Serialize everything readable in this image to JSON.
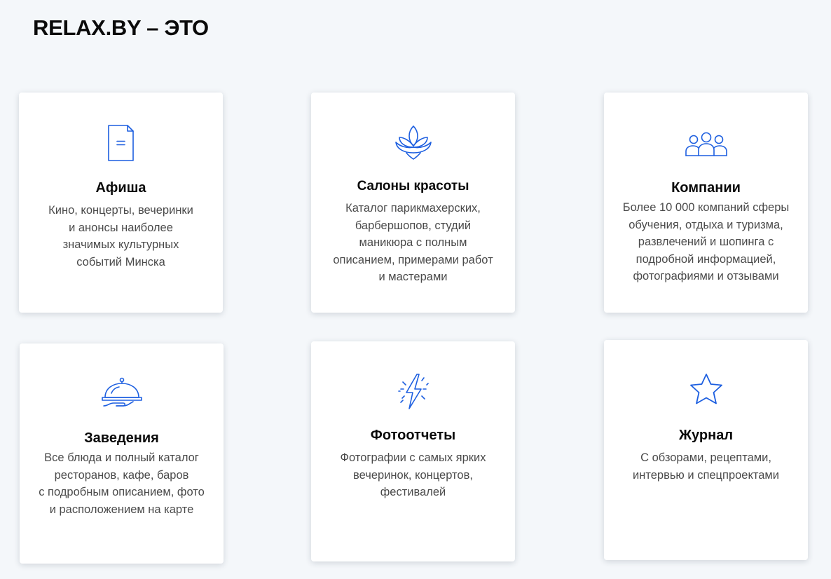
{
  "page": {
    "title": "RELAX.BY – ЭТО"
  },
  "colors": {
    "accent": "#1d5fe0",
    "background": "#f4f7fa",
    "card": "#ffffff"
  },
  "cards": [
    {
      "icon": "document-icon",
      "title": "Афиша",
      "description": "Кино, концерты, вечеринки\nи анонсы наиболее\nзначимых культурных\nсобытий Минска"
    },
    {
      "icon": "lotus-icon",
      "title": "Салоны красоты",
      "description": "Каталог парикмахерских,\nбарбершопов, студий\nманикюра с полным\nописанием, примерами работ\nи мастерами"
    },
    {
      "icon": "people-group-icon",
      "title": "Компании",
      "description": "Более 10 000 компаний сферы\nобучения, отдыха и туризма,\nразвлечений и шопинга с\nподробной информацией,\nфотографиями и отзывами"
    },
    {
      "icon": "cloche-serving-icon",
      "title": "Заведения",
      "description": "Все блюда и полный каталог\nресторанов, кафе, баров\nс подробным описанием, фото\nи расположением на карте"
    },
    {
      "icon": "lightning-icon",
      "title": "Фотоотчеты",
      "description": "Фотографии с самых ярких\nвечеринок, концертов,\nфестивалей"
    },
    {
      "icon": "star-icon",
      "title": "Журнал",
      "description": "С обзорами, рецептами,\nинтервью и спецпроектами"
    }
  ]
}
